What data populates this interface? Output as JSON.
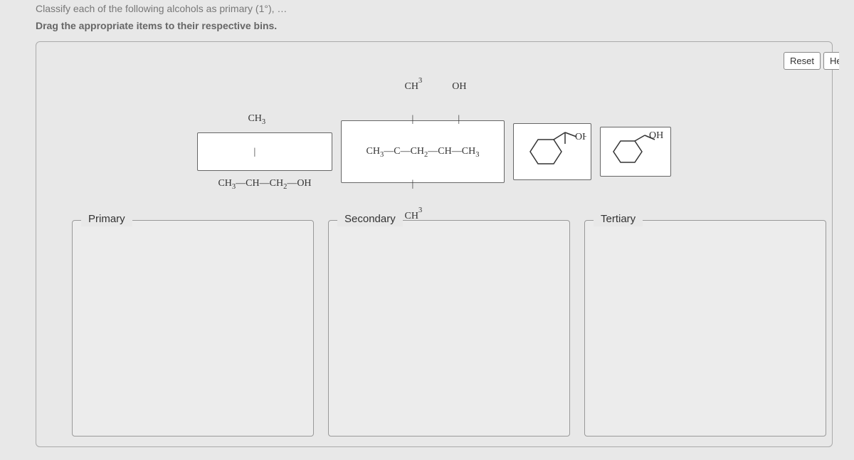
{
  "header": {
    "truncated": "Classify each of the following alcohols as primary (1°), …",
    "instruction": "Drag the appropriate items to their respective bins."
  },
  "buttons": {
    "reset": "Reset",
    "help": "Help"
  },
  "items": {
    "a": {
      "line1": "CH₃",
      "line2": "CH₃—CH—CH₂—OH"
    },
    "b": {
      "line1": "CH₃        OH",
      "line2": "CH₃—C—CH₂—CH—CH₃",
      "line3": "CH₃"
    },
    "c_label": "OH",
    "d_label": "OH"
  },
  "bins": {
    "primary": "Primary",
    "secondary": "Secondary",
    "tertiary": "Tertiary"
  }
}
